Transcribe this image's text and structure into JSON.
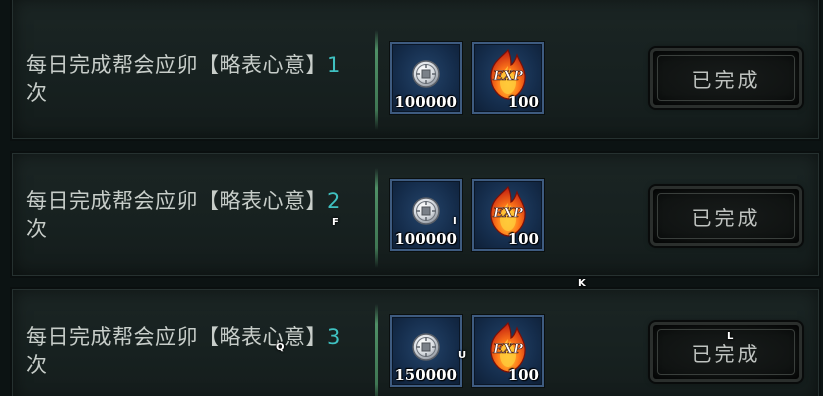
{
  "colors": {
    "panel_bg": "#172120",
    "desc_text": "#c7cdc9",
    "count_text": "#3fc1c1",
    "slot_bg": "#152d4c",
    "slot_border": "#3e5b80",
    "button_text": "#bfc3c0"
  },
  "tasks": [
    {
      "desc": "每日完成帮会应卯【略表心意】",
      "count": "1",
      "desc_suffix": "次",
      "rewards": [
        {
          "icon": "silver-coin-icon",
          "qty": "100000"
        },
        {
          "icon": "exp-flame-icon",
          "icon_text": "EXP",
          "qty": "100"
        }
      ],
      "status": "已完成"
    },
    {
      "desc": "每日完成帮会应卯【略表心意】",
      "count": "2",
      "desc_suffix": "次",
      "rewards": [
        {
          "icon": "silver-coin-icon",
          "qty": "100000"
        },
        {
          "icon": "exp-flame-icon",
          "icon_text": "EXP",
          "qty": "100"
        }
      ],
      "status": "已完成"
    },
    {
      "desc": "每日完成帮会应卯【略表心意】",
      "count": "3",
      "desc_suffix": "次",
      "rewards": [
        {
          "icon": "silver-coin-icon",
          "qty": "150000"
        },
        {
          "icon": "exp-flame-icon",
          "icon_text": "EXP",
          "qty": "100"
        }
      ],
      "status": "已完成"
    }
  ],
  "markers": [
    "F",
    "I",
    "K",
    "L",
    "Q",
    "U"
  ]
}
